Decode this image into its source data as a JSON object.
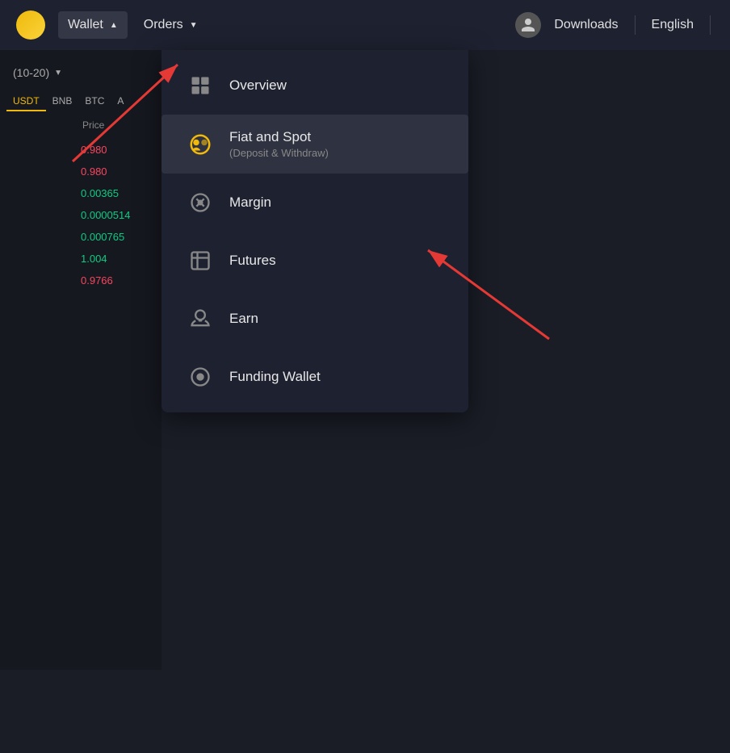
{
  "navbar": {
    "wallet_label": "Wallet",
    "orders_label": "Orders",
    "downloads_label": "Downloads",
    "english_label": "English",
    "wallet_arrow": "▲",
    "orders_arrow": "▼"
  },
  "sidebar": {
    "filter_label": "(10-20)",
    "tabs": [
      "USDT",
      "BNB",
      "BTC",
      "A"
    ],
    "header": {
      "col1": "",
      "col2": "Price"
    },
    "coins": [
      {
        "name": "",
        "price": "0.980",
        "color": "red"
      },
      {
        "name": "",
        "price": "0.980",
        "color": "red"
      },
      {
        "name": "",
        "price": "0.00365",
        "color": "green"
      },
      {
        "name": "",
        "price": "0.0000514",
        "color": "green"
      },
      {
        "name": "",
        "price": "0.000765",
        "color": "green"
      },
      {
        "name": "",
        "price": "1.004",
        "color": "green"
      },
      {
        "name": "",
        "price": "0.9766",
        "color": "red"
      }
    ]
  },
  "wallet_dropdown": {
    "items": [
      {
        "id": "overview",
        "label": "Overview",
        "sublabel": "",
        "icon": "grid"
      },
      {
        "id": "fiat-spot",
        "label": "Fiat and Spot",
        "sublabel": "(Deposit & Withdraw)",
        "icon": "fiat",
        "highlighted": true
      },
      {
        "id": "margin",
        "label": "Margin",
        "sublabel": "",
        "icon": "margin"
      },
      {
        "id": "futures",
        "label": "Futures",
        "sublabel": "",
        "icon": "futures"
      },
      {
        "id": "earn",
        "label": "Earn",
        "sublabel": "",
        "icon": "earn"
      },
      {
        "id": "funding",
        "label": "Funding Wallet",
        "sublabel": "",
        "icon": "funding"
      }
    ]
  },
  "colors": {
    "accent": "#f0b90b",
    "red": "#f6465d",
    "green": "#0ecb81",
    "bg_dark": "#161820",
    "bg_nav": "#1e2130"
  }
}
